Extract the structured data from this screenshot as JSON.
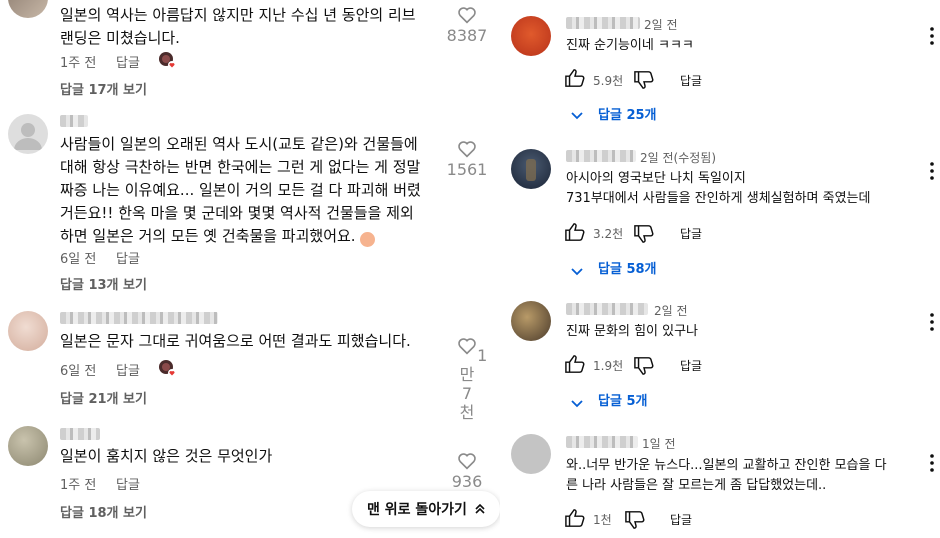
{
  "left_comments": [
    {
      "text": "일본의 역사는 아름답지 않지만 지난 수십 년 동안의 리브\n랜딩은 미쳤습니다.",
      "time": "1주 전",
      "reply_label": "답글",
      "likes": "8387",
      "replies": "답글 17개 보기",
      "avatar_colors": [
        "#8b7b6e",
        "#c8b8a8"
      ]
    },
    {
      "text": "사람들이 일본의 오래된 역사 도시(교토 같은)와 건물들에\n대해 항상 극찬하는 반면 한국에는 그런 게 없다는 게 정말\n짜증 나는 이유예요... 일본이 거의 모든 걸 다 파괴해 버렸\n거든요!! 한옥 마을 몇 군데와 몇몇 역사적 건물들을 제외\n하면 일본은 거의 모든 옛 건축물을 파괴했어요.",
      "emoji": "😞",
      "time": "6일 전",
      "reply_label": "답글",
      "likes": "1561",
      "replies": "답글 13개 보기",
      "avatar_colors": [
        "#dcdcdc",
        "#b8b8b8"
      ]
    },
    {
      "text": "일본은 문자 그대로 귀여움으로 어떤 결과도 피했습니다.",
      "time": "6일 전",
      "reply_label": "답글",
      "likes": "1\n만\n7\n천",
      "replies": "답글 21개 보기",
      "avatar_colors": [
        "#e8cfc4",
        "#d7b3a3"
      ]
    },
    {
      "text": "일본이 훔치지 않은 것은 무엇인가",
      "time": "1주 전",
      "reply_label": "답글",
      "likes": "936",
      "replies": "답글 18개 보기",
      "avatar_colors": [
        "#b5b09a",
        "#8c8770"
      ]
    }
  ],
  "back_to_top": "맨 위로 돌아가기",
  "right_comments": [
    {
      "time": "2일 전",
      "text": "진짜 순기능이네 ㅋㅋㅋ",
      "likes": "5.9천",
      "reply_label": "답글",
      "replies": "답글 25개",
      "avatar_colors": [
        "#c83c1e",
        "#e05a2c"
      ]
    },
    {
      "time": "2일 전(수정됨)",
      "text": "아시아의 영국보단 나치 독일이지\n731부대에서 사람들을 잔인하게 생체실험하며 죽였는데",
      "likes": "3.2천",
      "reply_label": "답글",
      "replies": "답글 58개",
      "avatar_colors": [
        "#1e2a3c",
        "#4a5a70"
      ]
    },
    {
      "time": "2일 전",
      "text": "진짜 문화의 힘이 있구나",
      "likes": "1.9천",
      "reply_label": "답글",
      "replies": "답글 5개",
      "avatar_colors": [
        "#5a4a3a",
        "#a08860"
      ]
    },
    {
      "time": "1일 전",
      "text": "와..너무 반가운 뉴스다...일본의 교활하고 잔인한 모습을 다\n른 나라 사람들은 잘 모르는게 좀 답답했었는데..",
      "likes": "1천",
      "reply_label": "답글",
      "avatar_colors": [
        "#c4c4c4",
        "#d4d4d4"
      ]
    }
  ],
  "icons": {
    "like": "thumbs-up-icon",
    "dislike": "thumbs-down-icon",
    "heart": "heart-outline-icon",
    "more": "vertical-ellipsis-icon",
    "expand": "chevron-down-icon",
    "up": "chevron-up-icon"
  },
  "colors": {
    "link_blue": "#065fd4",
    "muted": "#606060"
  }
}
